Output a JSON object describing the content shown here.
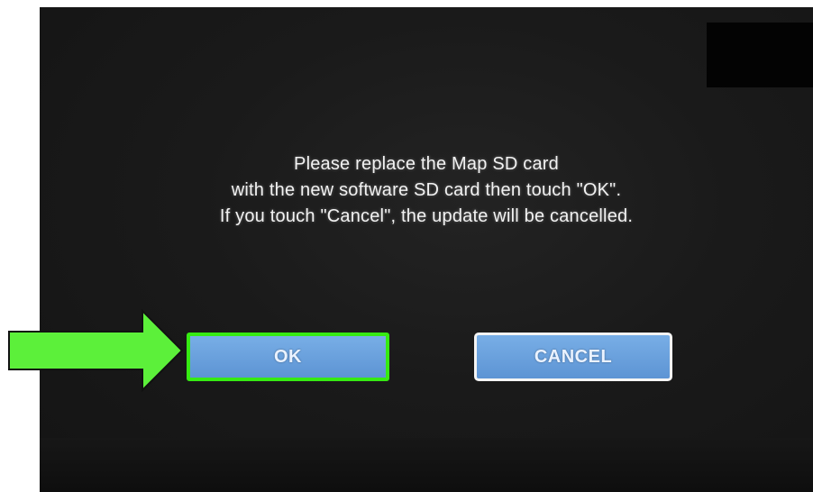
{
  "dialog": {
    "message_lines": [
      "Please replace the Map SD card",
      "with the new software SD card then touch \"OK\".",
      "If you touch \"Cancel\", the update will be cancelled."
    ]
  },
  "buttons": {
    "ok_label": "OK",
    "cancel_label": "CANCEL"
  },
  "annotation": {
    "icon": "arrow-right-icon",
    "highlight_color": "#36ea13"
  },
  "colors": {
    "screen_background": "#1a1a1a",
    "button_fill": "#6aa2df",
    "text": "#f2f2f2"
  }
}
